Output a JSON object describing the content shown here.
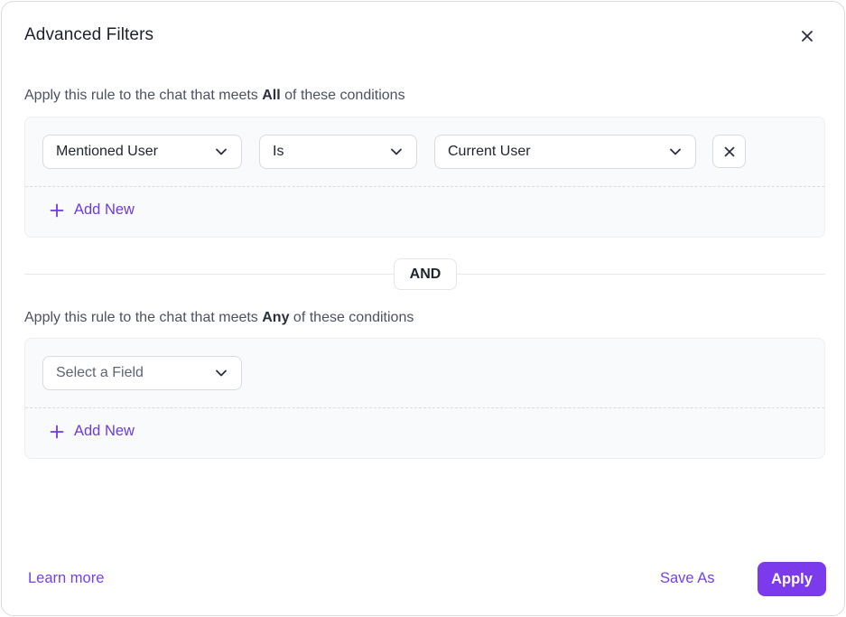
{
  "dialog": {
    "title": "Advanced Filters",
    "close_icon": "close-icon"
  },
  "all_section": {
    "label_prefix": "Apply this rule to the chat that meets ",
    "label_bold": "All",
    "label_suffix": " of these conditions",
    "condition": {
      "field": "Mentioned User",
      "operator": "Is",
      "value": "Current User"
    },
    "add_new": "Add New"
  },
  "connector": "AND",
  "any_section": {
    "label_prefix": "Apply this rule to the chat that meets ",
    "label_bold": "Any",
    "label_suffix": " of these conditions",
    "field_placeholder": "Select a Field",
    "add_new": "Add New"
  },
  "footer": {
    "learn_more": "Learn more",
    "save_as": "Save As",
    "apply": "Apply"
  },
  "colors": {
    "accent": "#7c3aed",
    "link": "#7443e8",
    "group_bg": "#f9fafb"
  }
}
